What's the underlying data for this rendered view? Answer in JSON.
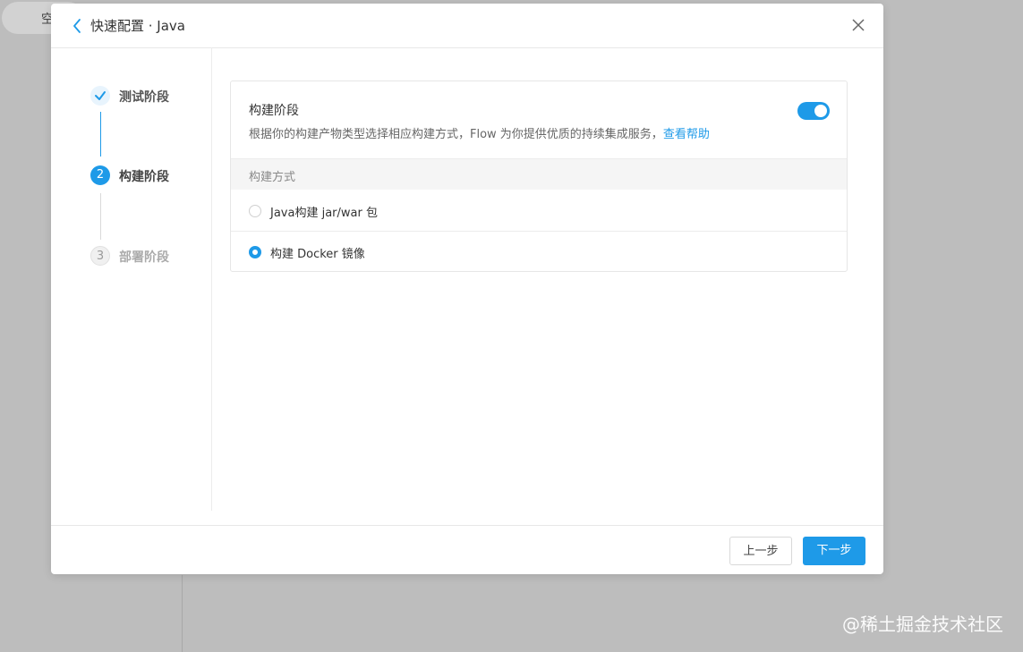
{
  "background": {
    "pill_text": "空",
    "watermark": "@稀土掘金技术社区"
  },
  "modal": {
    "title": "快速配置 · Java",
    "steps": [
      {
        "label": "测试阶段",
        "number": "",
        "state": "done"
      },
      {
        "label": "构建阶段",
        "number": "2",
        "state": "active"
      },
      {
        "label": "部署阶段",
        "number": "3",
        "state": "pending"
      }
    ],
    "card": {
      "title": "构建阶段",
      "description": "根据你的构建产物类型选择相应构建方式，Flow 为你提供优质的持续集成服务，",
      "help_link": "查看帮助",
      "toggle_on": true,
      "section_label": "构建方式",
      "options": [
        {
          "label": "Java构建 jar/war 包",
          "selected": false
        },
        {
          "label": "构建 Docker 镜像",
          "selected": true
        }
      ]
    },
    "footer": {
      "prev_label": "上一步",
      "next_label": "下一步"
    }
  },
  "colors": {
    "accent": "#1e9ae8",
    "overlay": "#bdbdbd"
  }
}
